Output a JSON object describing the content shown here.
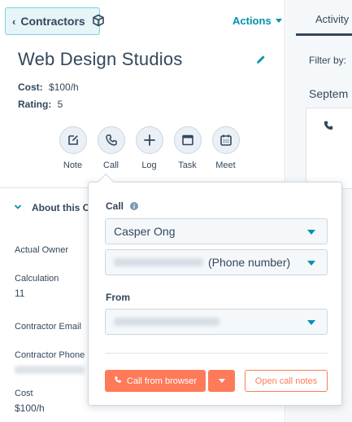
{
  "header": {
    "back_label": "Contractors",
    "actions_label": "Actions"
  },
  "record": {
    "title": "Web Design Studios",
    "cost_label": "Cost:",
    "cost_value": "$100/h",
    "rating_label": "Rating:",
    "rating_value": "5"
  },
  "activity_buttons": [
    {
      "label": "Note",
      "icon": "note-icon"
    },
    {
      "label": "Call",
      "icon": "phone-icon"
    },
    {
      "label": "Log",
      "icon": "plus-icon"
    },
    {
      "label": "Task",
      "icon": "task-icon"
    },
    {
      "label": "Meet",
      "icon": "calendar-icon"
    }
  ],
  "about": {
    "heading": "About this Co",
    "fields": [
      {
        "label": "Actual Owner",
        "value": ""
      },
      {
        "label": "Calculation",
        "value": "11"
      },
      {
        "label": "Contractor Email",
        "value": ""
      },
      {
        "label": "Contractor Phone N",
        "value": ""
      },
      {
        "label": "Cost",
        "value": "$100/h"
      }
    ]
  },
  "right_panel": {
    "tab_activity": "Activity",
    "filter_label": "Filter by:",
    "month_label": "Septem"
  },
  "call_popover": {
    "call_label": "Call",
    "contact_value": "Casper Ong",
    "phone_type": "(Phone number)",
    "from_label": "From",
    "call_button": "Call from browser",
    "open_notes_button": "Open call notes"
  },
  "colors": {
    "accent": "#0091ae",
    "primary_button": "#ff7a59",
    "text": "#33475b",
    "back_button_bg": "#e5f5f8"
  }
}
